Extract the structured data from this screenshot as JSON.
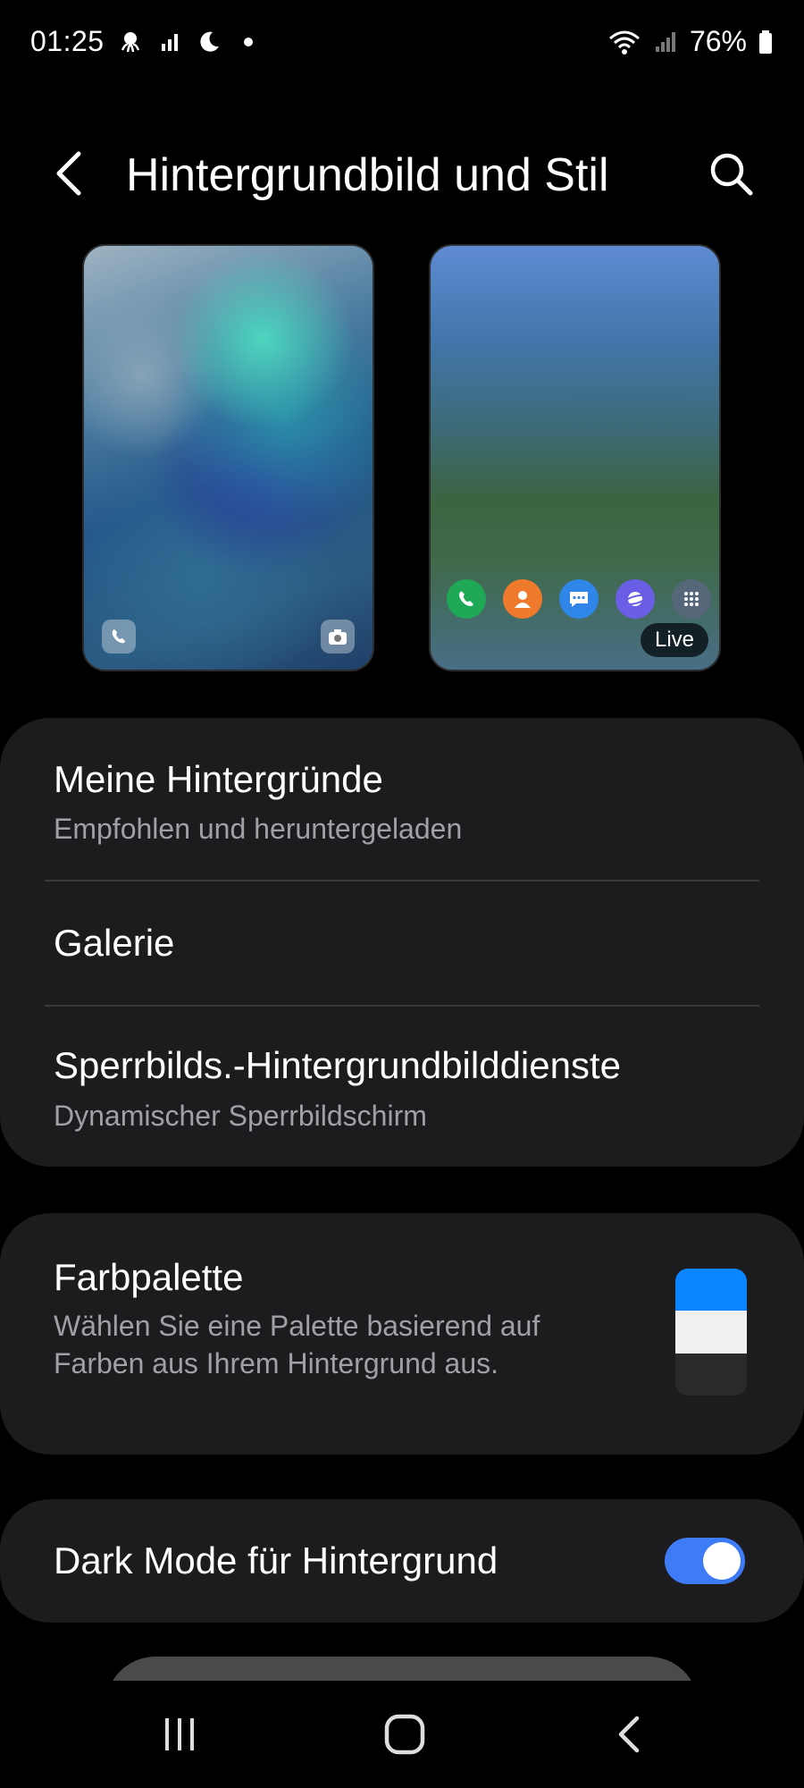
{
  "status_bar": {
    "time": "01:25",
    "battery": "76%"
  },
  "header": {
    "title": "Hintergrundbild und Stil"
  },
  "previews": {
    "home_badge": "Live"
  },
  "menu": {
    "my_wallpapers": {
      "title": "Meine Hintergründe",
      "subtitle": "Empfohlen und heruntergeladen"
    },
    "gallery": {
      "title": "Galerie"
    },
    "lockscreen_services": {
      "title": "Sperrbilds.-Hintergrundbilddienste",
      "subtitle": "Dynamischer Sperrbildschirm"
    }
  },
  "palette": {
    "title": "Farbpalette",
    "subtitle_line1": "Wählen Sie eine Palette basierend auf",
    "subtitle_line2": "Farben aus Ihrem Hintergrund aus.",
    "swatch_colors": [
      "#0a84ff",
      "#f0f0f0",
      "#2a2a2c"
    ]
  },
  "dark_mode": {
    "title": "Dark Mode für Hintergrund",
    "enabled": true
  },
  "colors": {
    "accent": "#3e7bf6",
    "card": "#1c1c1e",
    "subtext": "#a0a0a5"
  },
  "icons": {
    "status_left": [
      "octopus-notification-icon",
      "signal-bars-icon",
      "moon-icon",
      "dot-icon"
    ],
    "status_right": [
      "wifi-icon",
      "signal-icon",
      "battery-icon"
    ],
    "dock": [
      "phone-app-icon",
      "contacts-app-icon",
      "messages-app-icon",
      "internet-app-icon",
      "apps-grid-icon"
    ],
    "nav": [
      "recents-icon",
      "home-icon",
      "back-icon"
    ]
  }
}
